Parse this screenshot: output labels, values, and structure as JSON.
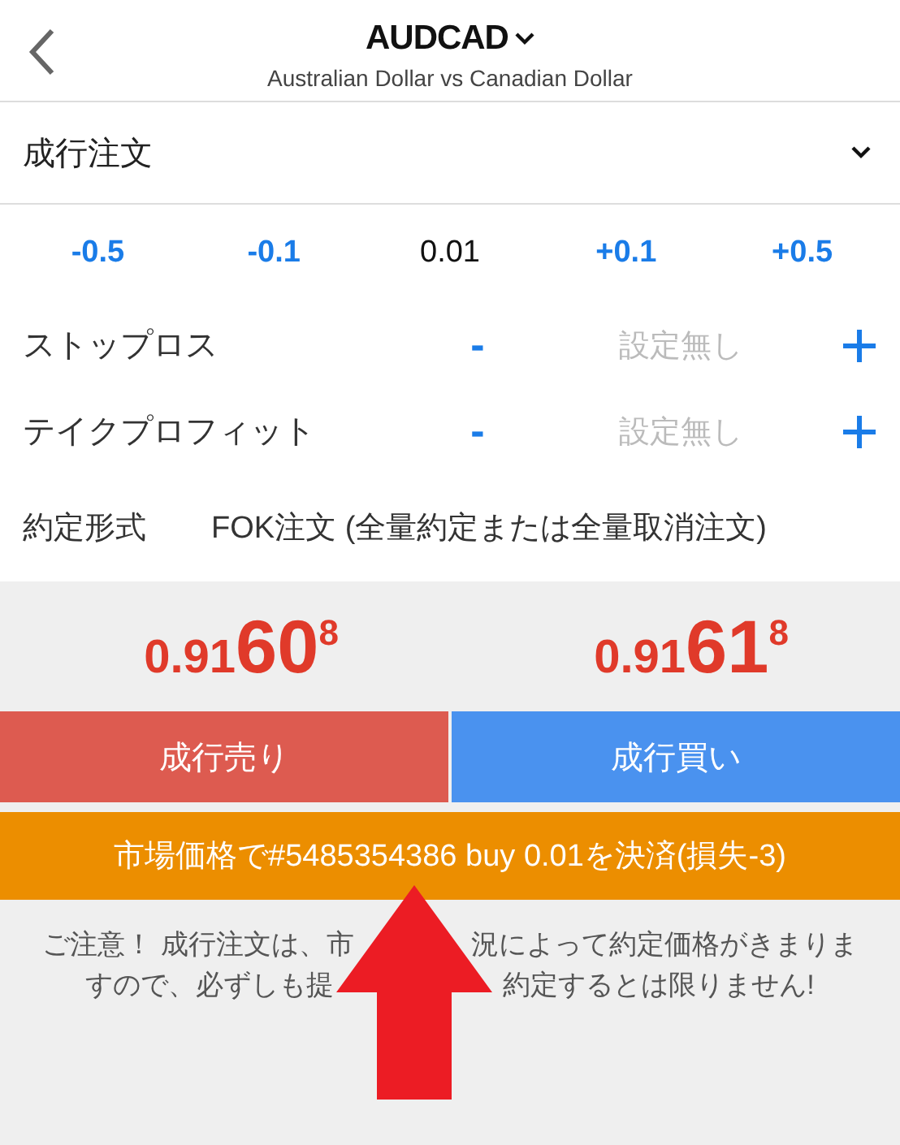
{
  "header": {
    "symbol": "AUDCAD",
    "description": "Australian Dollar vs Canadian Dollar"
  },
  "order_type": {
    "label": "成行注文"
  },
  "lot_steps": [
    {
      "kind": "step",
      "label": "-0.5"
    },
    {
      "kind": "step",
      "label": "-0.1"
    },
    {
      "kind": "value",
      "label": "0.01"
    },
    {
      "kind": "step",
      "label": "+0.1"
    },
    {
      "kind": "step",
      "label": "+0.5"
    }
  ],
  "stop_rows": [
    {
      "label": "ストップロス",
      "minus": "-",
      "placeholder": "設定無し"
    },
    {
      "label": "テイクプロフィット",
      "minus": "-",
      "placeholder": "設定無し"
    }
  ],
  "fill_policy": {
    "label": "約定形式",
    "value": "FOK注文 (全量約定または全量取消注文)"
  },
  "prices": [
    {
      "prefix": "0.91",
      "big": "60",
      "sup": "8"
    },
    {
      "prefix": "0.91",
      "big": "61",
      "sup": "8"
    }
  ],
  "trade_buttons": [
    {
      "kind": "sell",
      "label": "成行売り"
    },
    {
      "kind": "buy",
      "label": "成行買い"
    }
  ],
  "close_button": {
    "label": "市場価格で#5485354386 buy 0.01を決済(損失-3)"
  },
  "notice_lines": [
    [
      "ご注意！ 成行注文は、市",
      "況によって約定価格がきまりま"
    ],
    [
      "すので、必ずしも提",
      "約定するとは限りません!"
    ]
  ],
  "annotation": {
    "kind": "up-arrow"
  }
}
